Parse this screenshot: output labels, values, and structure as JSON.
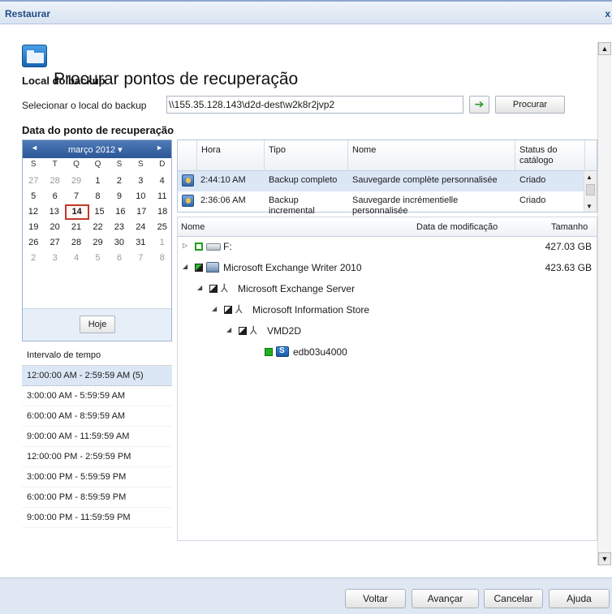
{
  "window": {
    "title": "Restaurar",
    "close_label": "x"
  },
  "header": {
    "icon": "folder-open-icon",
    "title": "Procurar pontos de recuperação"
  },
  "backup_location": {
    "section_label": "Local do backup",
    "select_label": "Selecionar o local do backup",
    "path_value": "\\\\155.35.128.143\\d2d-dest\\w2k8r2jvp2",
    "go_icon": "arrow-right-icon",
    "browse_label": "Procurar"
  },
  "recovery_date": {
    "section_label": "Data do ponto de recuperação",
    "calendar": {
      "month_label": "março 2012 ▾",
      "prev_label": "◄",
      "next_label": "►",
      "weekdays": [
        "S",
        "T",
        "Q",
        "Q",
        "S",
        "S",
        "D"
      ],
      "weeks": [
        [
          "27",
          "28",
          "29",
          "1",
          "2",
          "3",
          "4"
        ],
        [
          "5",
          "6",
          "7",
          "8",
          "9",
          "10",
          "11"
        ],
        [
          "12",
          "13",
          "14",
          "15",
          "16",
          "17",
          "18"
        ],
        [
          "19",
          "20",
          "21",
          "22",
          "23",
          "24",
          "25"
        ],
        [
          "26",
          "27",
          "28",
          "29",
          "30",
          "31",
          "1"
        ],
        [
          "2",
          "3",
          "4",
          "5",
          "6",
          "7",
          "8"
        ]
      ],
      "selected_day": "14",
      "today_label": "Hoje"
    },
    "time_ranges": {
      "header": "Intervalo de tempo",
      "items": [
        "12:00:00 AM - 2:59:59 AM (5)",
        "3:00:00 AM - 5:59:59 AM",
        "6:00:00 AM - 8:59:59 AM",
        "9:00:00 AM - 11:59:59 AM",
        "12:00:00 PM - 2:59:59 PM",
        "3:00:00 PM - 5:59:59 PM",
        "6:00:00 PM - 8:59:59 PM",
        "9:00:00 PM - 11:59:59 PM"
      ],
      "selected_index": 0
    }
  },
  "recovery_points": {
    "columns": [
      "Hora",
      "Tipo",
      "Nome",
      "Status do catálogo"
    ],
    "rows": [
      {
        "hora": "2:44:10 AM",
        "tipo": "Backup completo",
        "nome": "Sauvegarde complète personnalisée",
        "status": "Criado"
      },
      {
        "hora": "2:36:06 AM",
        "tipo": "Backup incremental",
        "nome": "Sauvegarde incrémentielle personnalisée",
        "status": "Criado"
      }
    ],
    "selected_index": 0
  },
  "tree": {
    "columns": [
      "Nome",
      "Data de modificação",
      "Tamanho"
    ],
    "nodes": [
      {
        "name": "F:",
        "size": "427.03 GB",
        "icon": "drive-icon"
      },
      {
        "name": "Microsoft Exchange Writer 2010",
        "size": "423.63 GB",
        "icon": "server-icon"
      },
      {
        "name": "Microsoft Exchange Server",
        "size": "",
        "icon": "users-icon"
      },
      {
        "name": "Microsoft Information Store",
        "size": "",
        "icon": "users-icon"
      },
      {
        "name": "VMD2D",
        "size": "",
        "icon": "users-icon"
      },
      {
        "name": "edb03u4000",
        "size": "",
        "icon": "database-icon"
      }
    ]
  },
  "footer": {
    "back_label": "Voltar",
    "next_label": "Avançar",
    "cancel_label": "Cancelar",
    "help_label": "Ajuda"
  }
}
